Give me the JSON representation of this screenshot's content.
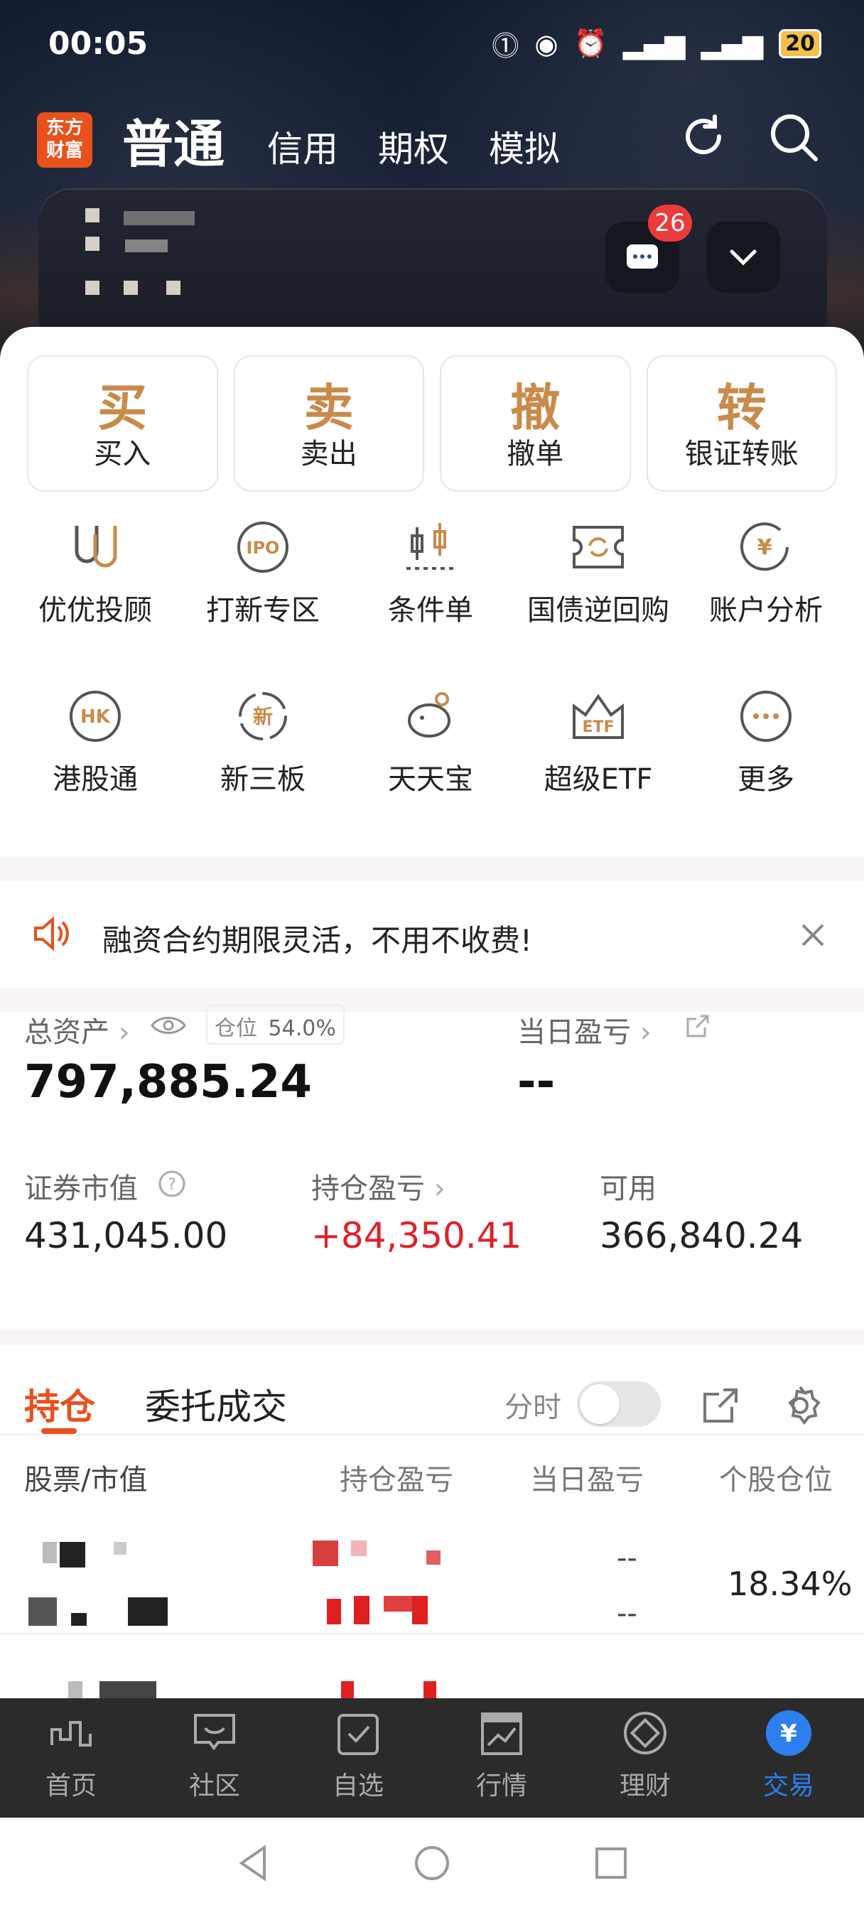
{
  "status_bar": {
    "time": "00:05",
    "battery": "20"
  },
  "top_nav": {
    "logo_text": "东方\n财富",
    "main_tab": "普通",
    "tabs": [
      "信用",
      "期权",
      "模拟"
    ]
  },
  "message_badge": "26",
  "actions": [
    {
      "glyph": "买",
      "label": "买入"
    },
    {
      "glyph": "卖",
      "label": "卖出"
    },
    {
      "glyph": "撤",
      "label": "撤单"
    },
    {
      "glyph": "转",
      "label": "银证转账"
    }
  ],
  "grid1": [
    "优优投顾",
    "打新专区",
    "条件单",
    "国债逆回购",
    "账户分析"
  ],
  "grid2": [
    "港股通",
    "新三板",
    "天天宝",
    "超级ETF",
    "更多"
  ],
  "grid_icon_text": {
    "ipo": "IPO",
    "hk": "HK",
    "xin": "新",
    "etf": "ETF",
    "yen": "¥"
  },
  "notice": {
    "text": "融资合约期限灵活，不用不收费!"
  },
  "assets": {
    "total_label": "总资产",
    "position_tag_label": "仓位",
    "position_tag_value": "54.0%",
    "total_value": "797,885.24",
    "daily_pl_label": "当日盈亏",
    "daily_pl_value": "--",
    "market_value_label": "证券市值",
    "market_value": "431,045.00",
    "holding_pl_label": "持仓盈亏",
    "holding_pl": "+84,350.41",
    "available_label": "可用",
    "available": "366,840.24"
  },
  "holdings_tabs": {
    "active": "持仓",
    "other": "委托成交",
    "toggle_label": "分时"
  },
  "table_headers": [
    "股票/市值",
    "持仓盈亏",
    "当日盈亏",
    "个股仓位"
  ],
  "rows": [
    {
      "daily_top": "--",
      "daily_bottom": "--",
      "position": "18.34%"
    }
  ],
  "bottom_nav": [
    {
      "label": "首页"
    },
    {
      "label": "社区"
    },
    {
      "label": "自选"
    },
    {
      "label": "行情"
    },
    {
      "label": "理财"
    },
    {
      "label": "交易",
      "active": true
    }
  ],
  "bottom_nav_icon_text": "¥",
  "colors": {
    "accent": "#e8501c",
    "gold": "#c98a4a",
    "red": "#e0202a",
    "blue": "#2d7ff0"
  }
}
